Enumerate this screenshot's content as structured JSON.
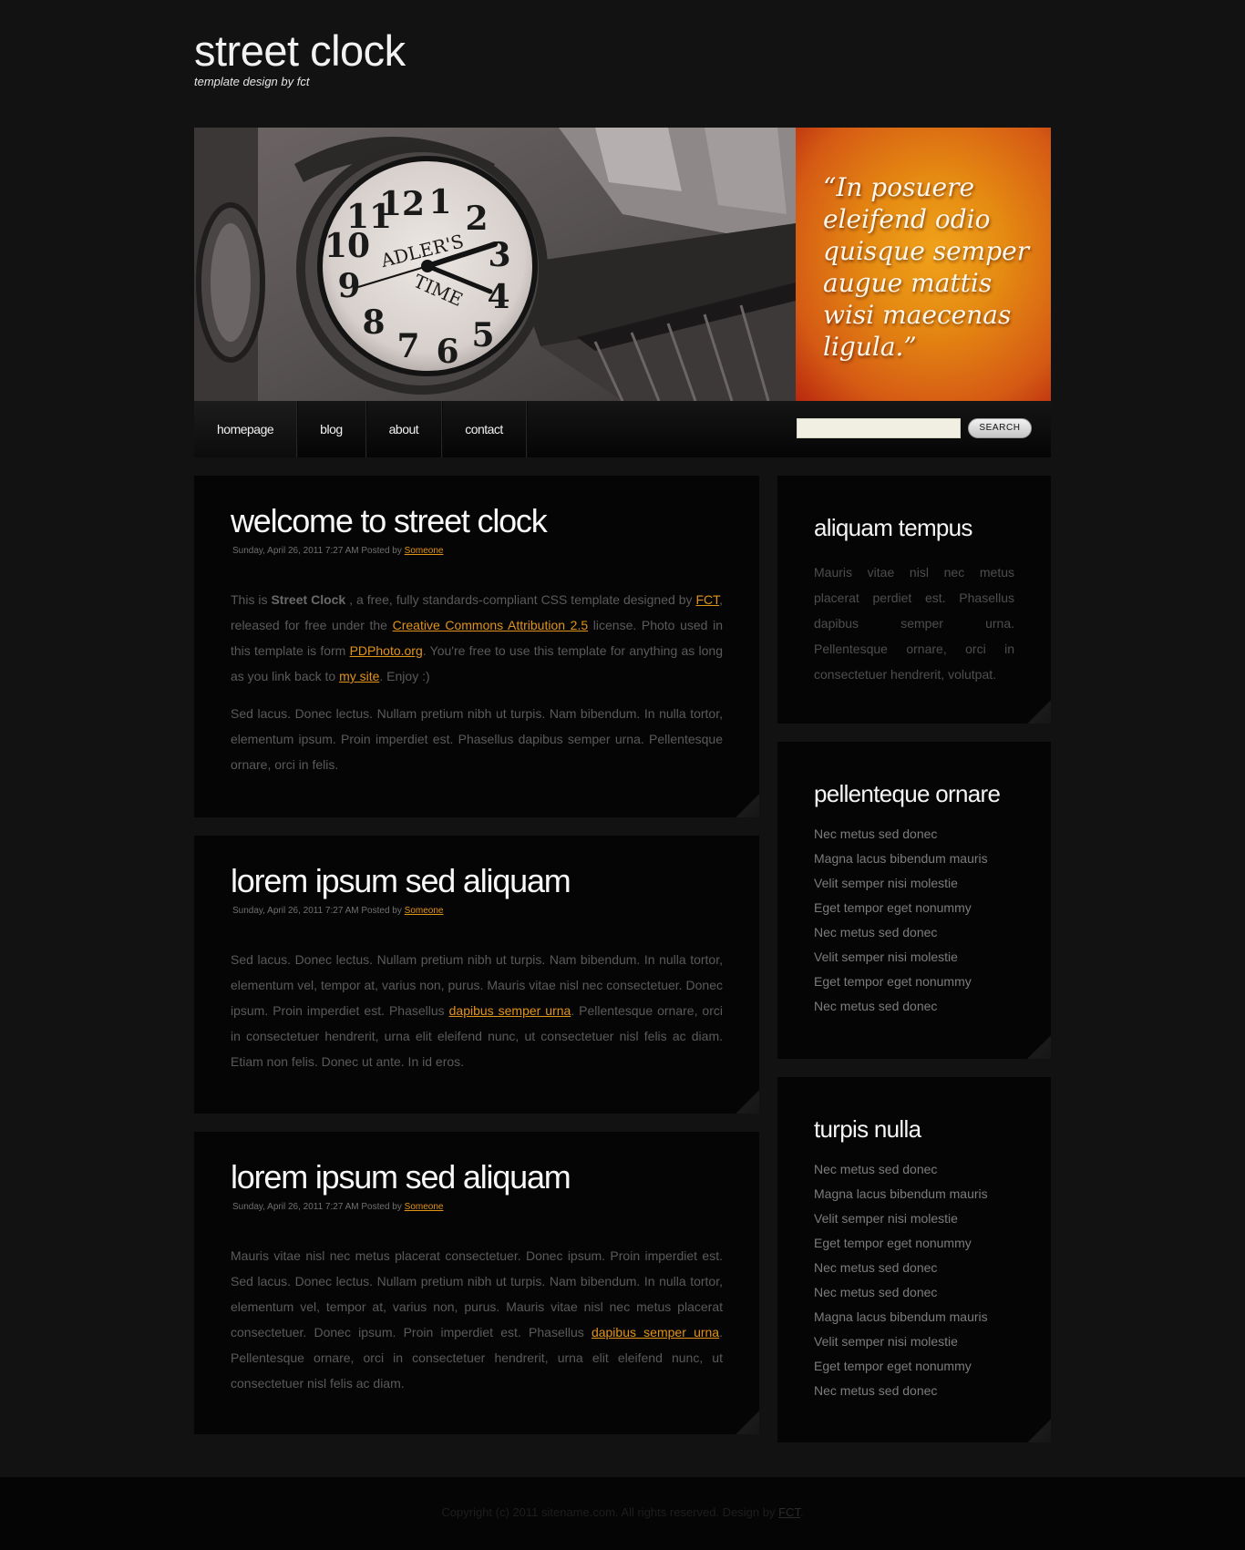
{
  "site": {
    "title": "street clock",
    "tagline": "template design by fct"
  },
  "banner": {
    "clock_brand": "ADLER'S",
    "clock_word": "TIME",
    "clock_numbers": [
      "12",
      "1",
      "2",
      "3",
      "4",
      "5",
      "6",
      "7",
      "8",
      "9",
      "10",
      "11"
    ],
    "quote": "“In posuere eleifend odio quisque semper augue mattis wisi maecenas ligula.”"
  },
  "nav": {
    "items": [
      {
        "label": "homepage"
      },
      {
        "label": "blog"
      },
      {
        "label": "about"
      },
      {
        "label": "contact"
      }
    ],
    "search_placeholder": "",
    "search_button": "SEARCH"
  },
  "posts": [
    {
      "title": "welcome to street clock",
      "meta_date": "Sunday, April 26, 2011 7:27 AM Posted by",
      "author": "Someone",
      "p1": {
        "a": "This is ",
        "b": "Street Clock",
        "c": " , a free, fully standards-compliant CSS template designed by ",
        "link1": "FCT",
        "d": ", released for free under the ",
        "link2": "Creative Commons Attribution 2.5",
        "e": " license. Photo used in this template is form ",
        "link3": "PDPhoto.org",
        "f": ". You're free to use this template for anything as long as you link back to ",
        "link4": "my site",
        "g": ". Enjoy :)"
      },
      "p2": "Sed lacus. Donec lectus. Nullam pretium nibh ut turpis. Nam bibendum. In nulla tortor, elementum ipsum. Proin imperdiet est. Phasellus dapibus semper urna. Pellentesque ornare, orci in felis."
    },
    {
      "title": "lorem ipsum sed aliquam",
      "meta_date": "Sunday, April 26, 2011 7:27 AM Posted by",
      "author": "Someone",
      "p1": {
        "a": "Sed lacus. Donec lectus. Nullam pretium nibh ut turpis. Nam bibendum. In nulla tortor, elementum vel, tempor at, varius non, purus. Mauris vitae nisl nec consectetuer. Donec ipsum. Proin imperdiet est. Phasellus ",
        "link": "dapibus semper urna",
        "b": ". Pellentesque ornare, orci in consectetuer hendrerit, urna elit eleifend nunc, ut consectetuer nisl felis ac diam. Etiam non felis. Donec ut ante. In id eros."
      }
    },
    {
      "title": "lorem ipsum sed aliquam",
      "meta_date": "Sunday, April 26, 2011 7:27 AM Posted by",
      "author": "Someone",
      "p1": {
        "a": "Mauris vitae nisl nec metus placerat consectetuer. Donec ipsum. Proin imperdiet est. Sed lacus. Donec lectus. Nullam pretium nibh ut turpis. Nam bibendum. In nulla tortor, elementum vel, tempor at, varius non, purus. Mauris vitae nisl nec metus placerat consectetuer. Donec ipsum. Proin imperdiet est. Phasellus ",
        "link": "dapibus semper urna",
        "b": ". Pellentesque ornare, orci in consectetuer hendrerit, urna elit eleifend nunc, ut consectetuer nisl felis ac diam."
      }
    }
  ],
  "sidebar": {
    "box1": {
      "title": "aliquam tempus",
      "text": "Mauris vitae nisl nec metus placerat perdiet est. Phasellus dapibus semper urna. Pellentesque ornare, orci in consectetuer hendrerit, volutpat."
    },
    "box2": {
      "title": "pellenteque ornare",
      "items": [
        "Nec metus sed donec",
        "Magna lacus bibendum mauris",
        "Velit semper nisi molestie",
        "Eget tempor eget nonummy",
        "Nec metus sed donec",
        "Velit semper nisi molestie",
        "Eget tempor eget nonummy",
        "Nec metus sed donec"
      ]
    },
    "box3": {
      "title": "turpis nulla",
      "items": [
        "Nec metus sed donec",
        "Magna lacus bibendum mauris",
        "Velit semper nisi molestie",
        "Eget tempor eget nonummy",
        "Nec metus sed donec",
        "Nec metus sed donec",
        "Magna lacus bibendum mauris",
        "Velit semper nisi molestie",
        "Eget tempor eget nonummy",
        "Nec metus sed donec"
      ]
    }
  },
  "footer": {
    "text": "Copyright (c) 2011 sitename.com. All rights reserved. Design by ",
    "link": "FCT",
    "end": "."
  },
  "colors": {
    "page_bg": "#121212",
    "panel_bg": "#050505",
    "link": "#e2931a",
    "quote_orange": "#e58a12"
  }
}
